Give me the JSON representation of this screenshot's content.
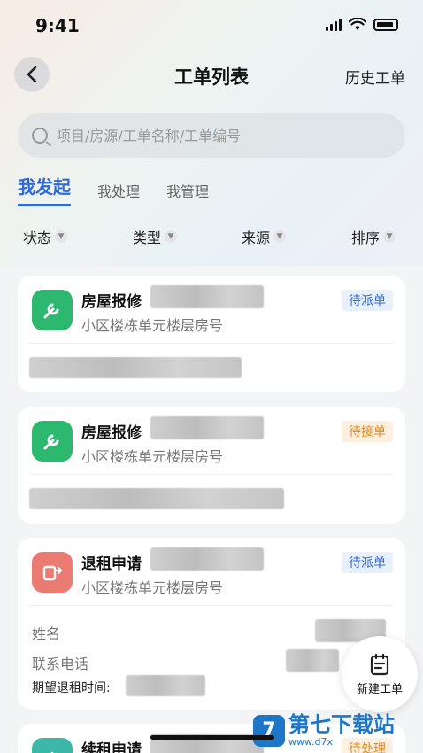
{
  "status": {
    "time": "9:41"
  },
  "nav": {
    "title": "工单列表",
    "history": "历史工单"
  },
  "search": {
    "placeholder": "项目/房源/工单名称/工单编号"
  },
  "tabs": [
    {
      "label": "我发起"
    },
    {
      "label": "我处理"
    },
    {
      "label": "我管理"
    }
  ],
  "filters": [
    {
      "label": "状态"
    },
    {
      "label": "类型"
    },
    {
      "label": "来源"
    },
    {
      "label": "排序"
    }
  ],
  "cards": [
    {
      "title": "房屋报修",
      "sub": "小区楼栋单元楼层房号",
      "badge": "待派单",
      "icon": "wrench-icon"
    },
    {
      "title": "房屋报修",
      "sub": "小区楼栋单元楼层房号",
      "badge": "待接单",
      "icon": "wrench-icon"
    },
    {
      "title": "退租申请",
      "sub": "小区楼栋单元楼层房号",
      "badge": "待派单",
      "icon": "move-out-icon",
      "fields": {
        "name": "姓名",
        "phone": "联系电话",
        "date": "期望退租时间:"
      }
    },
    {
      "title": "续租申请",
      "badge": "待处理",
      "icon": "renew-icon"
    }
  ],
  "fab": {
    "label": "新建工单"
  },
  "watermark": {
    "text": "第七下载站",
    "url": "www.d7x",
    "logo": "7"
  },
  "colors": {
    "accent": "#2f6bd8",
    "green": "#2db86f",
    "red": "#e97b73",
    "orange": "#e68a1e"
  }
}
